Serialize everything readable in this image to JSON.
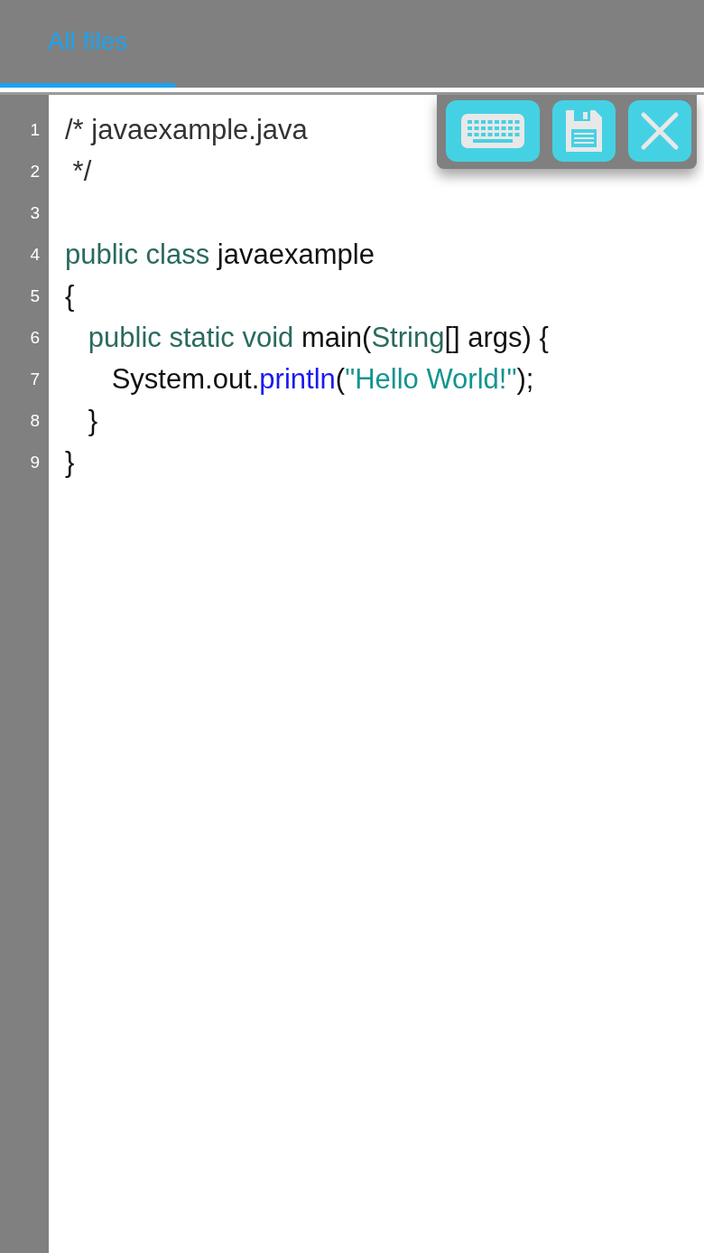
{
  "tabs": [
    {
      "label": "All files",
      "selected": true
    }
  ],
  "toolbar": {
    "buttons": [
      {
        "kind": "keyboard"
      },
      {
        "kind": "save"
      },
      {
        "kind": "close"
      }
    ]
  },
  "editor": {
    "lines": [
      {
        "number": "1",
        "tokens": [
          {
            "text": "/* javaexample.java",
            "kind": "comment"
          }
        ]
      },
      {
        "number": "2",
        "tokens": [
          {
            "text": " */",
            "kind": "comment"
          }
        ]
      },
      {
        "number": "3"
      },
      {
        "number": "4",
        "tokens": [
          {
            "text": "public class",
            "kind": "keyword"
          },
          {
            "text": " javaexample",
            "kind": "plain"
          }
        ]
      },
      {
        "number": "5",
        "tokens": [
          {
            "text": "{",
            "kind": "plain"
          }
        ]
      },
      {
        "number": "6",
        "tokens": [
          {
            "text": "   public static void",
            "kind": "keyword"
          },
          {
            "text": " main(",
            "kind": "plain"
          },
          {
            "text": "String",
            "kind": "keyword"
          },
          {
            "text": "[] args) {",
            "kind": "plain"
          }
        ]
      },
      {
        "number": "7",
        "tokens": [
          {
            "text": "      System.out.",
            "kind": "plain"
          },
          {
            "text": "println",
            "kind": "method"
          },
          {
            "text": "(",
            "kind": "plain"
          },
          {
            "text": "\"Hello World!\"",
            "kind": "string"
          },
          {
            "text": ");",
            "kind": "plain"
          }
        ]
      },
      {
        "number": "8",
        "tokens": [
          {
            "text": "   }",
            "kind": "plain"
          }
        ]
      },
      {
        "number": "9",
        "tokens": [
          {
            "text": "}",
            "kind": "plain"
          }
        ]
      }
    ]
  }
}
